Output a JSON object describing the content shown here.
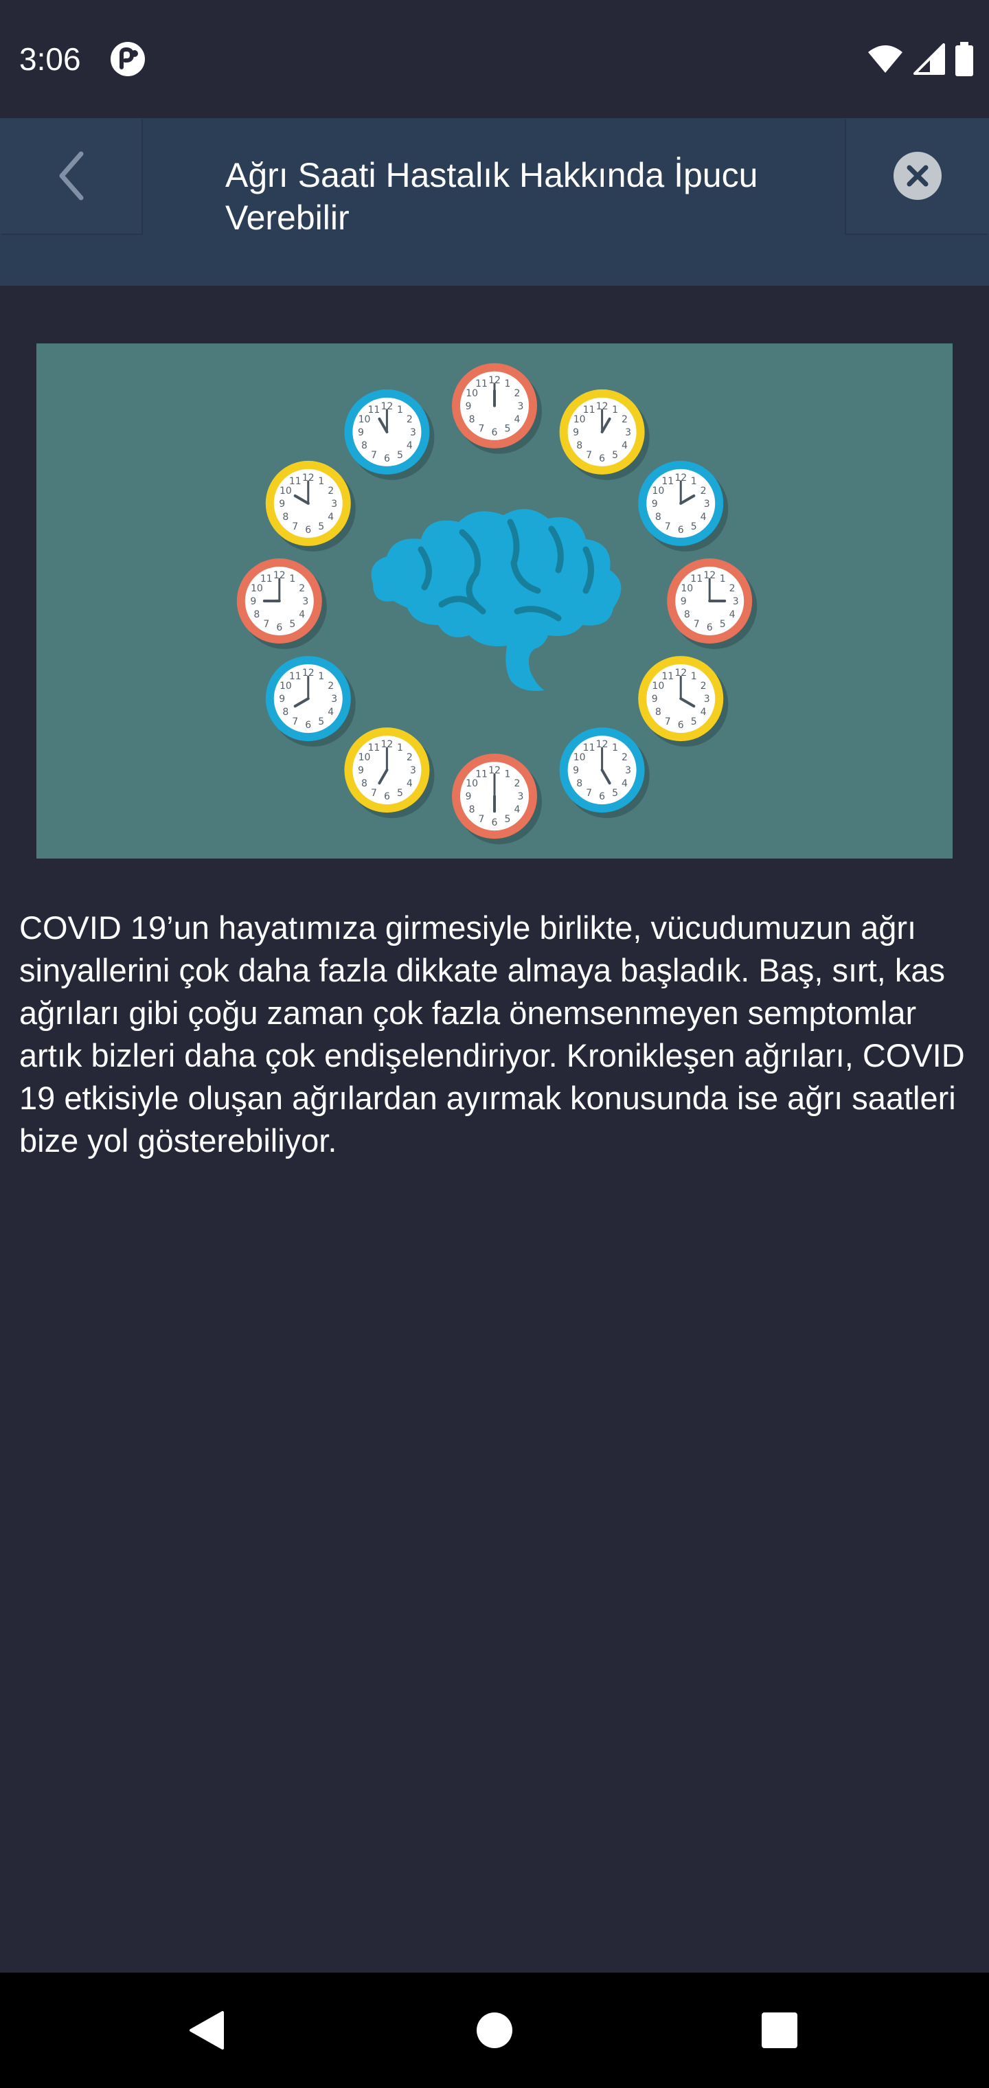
{
  "status_bar": {
    "time": "3:06",
    "app_icon": "app-notification-icon",
    "icons": [
      "wifi-icon",
      "cellular-signal-icon",
      "battery-icon"
    ]
  },
  "header": {
    "title": "Ağrı Saati Hastalık Hakkında İpucu Verebilir",
    "back_icon": "chevron-left-icon",
    "close_icon": "close-circle-icon"
  },
  "hero_image": {
    "description_icon": "brain-with-clocks-illustration",
    "clock_numerals": [
      "12",
      "1",
      "2",
      "3",
      "4",
      "5",
      "6",
      "7",
      "8",
      "9",
      "10",
      "11"
    ],
    "colors": {
      "background": "#4d7a7b",
      "brain": "#1ba8d6",
      "coral": "#e8735b",
      "yellow": "#f5cf1f",
      "cyan": "#1ba8d6"
    }
  },
  "article": {
    "body": "COVID 19’un hayatımıza girmesiyle birlikte, vücudumuzun ağrı sinyallerini çok daha fazla dikkate almaya başladık. Baş, sırt, kas ağrıları gibi çoğu zaman çok fazla önemsenmeyen semptomlar artık bizleri daha çok endişelendiriyor. Kronikleşen ağrıları, COVID 19 etkisiyle oluşan ağrılardan ayırmak konusunda ise ağrı saatleri bize yol gösterebiliyor."
  },
  "nav_bar": {
    "back_icon": "nav-back-icon",
    "home_icon": "nav-home-icon",
    "recents_icon": "nav-recents-icon"
  },
  "colors": {
    "background": "#262838",
    "header": "#2c3e55",
    "text": "#ffffff"
  }
}
